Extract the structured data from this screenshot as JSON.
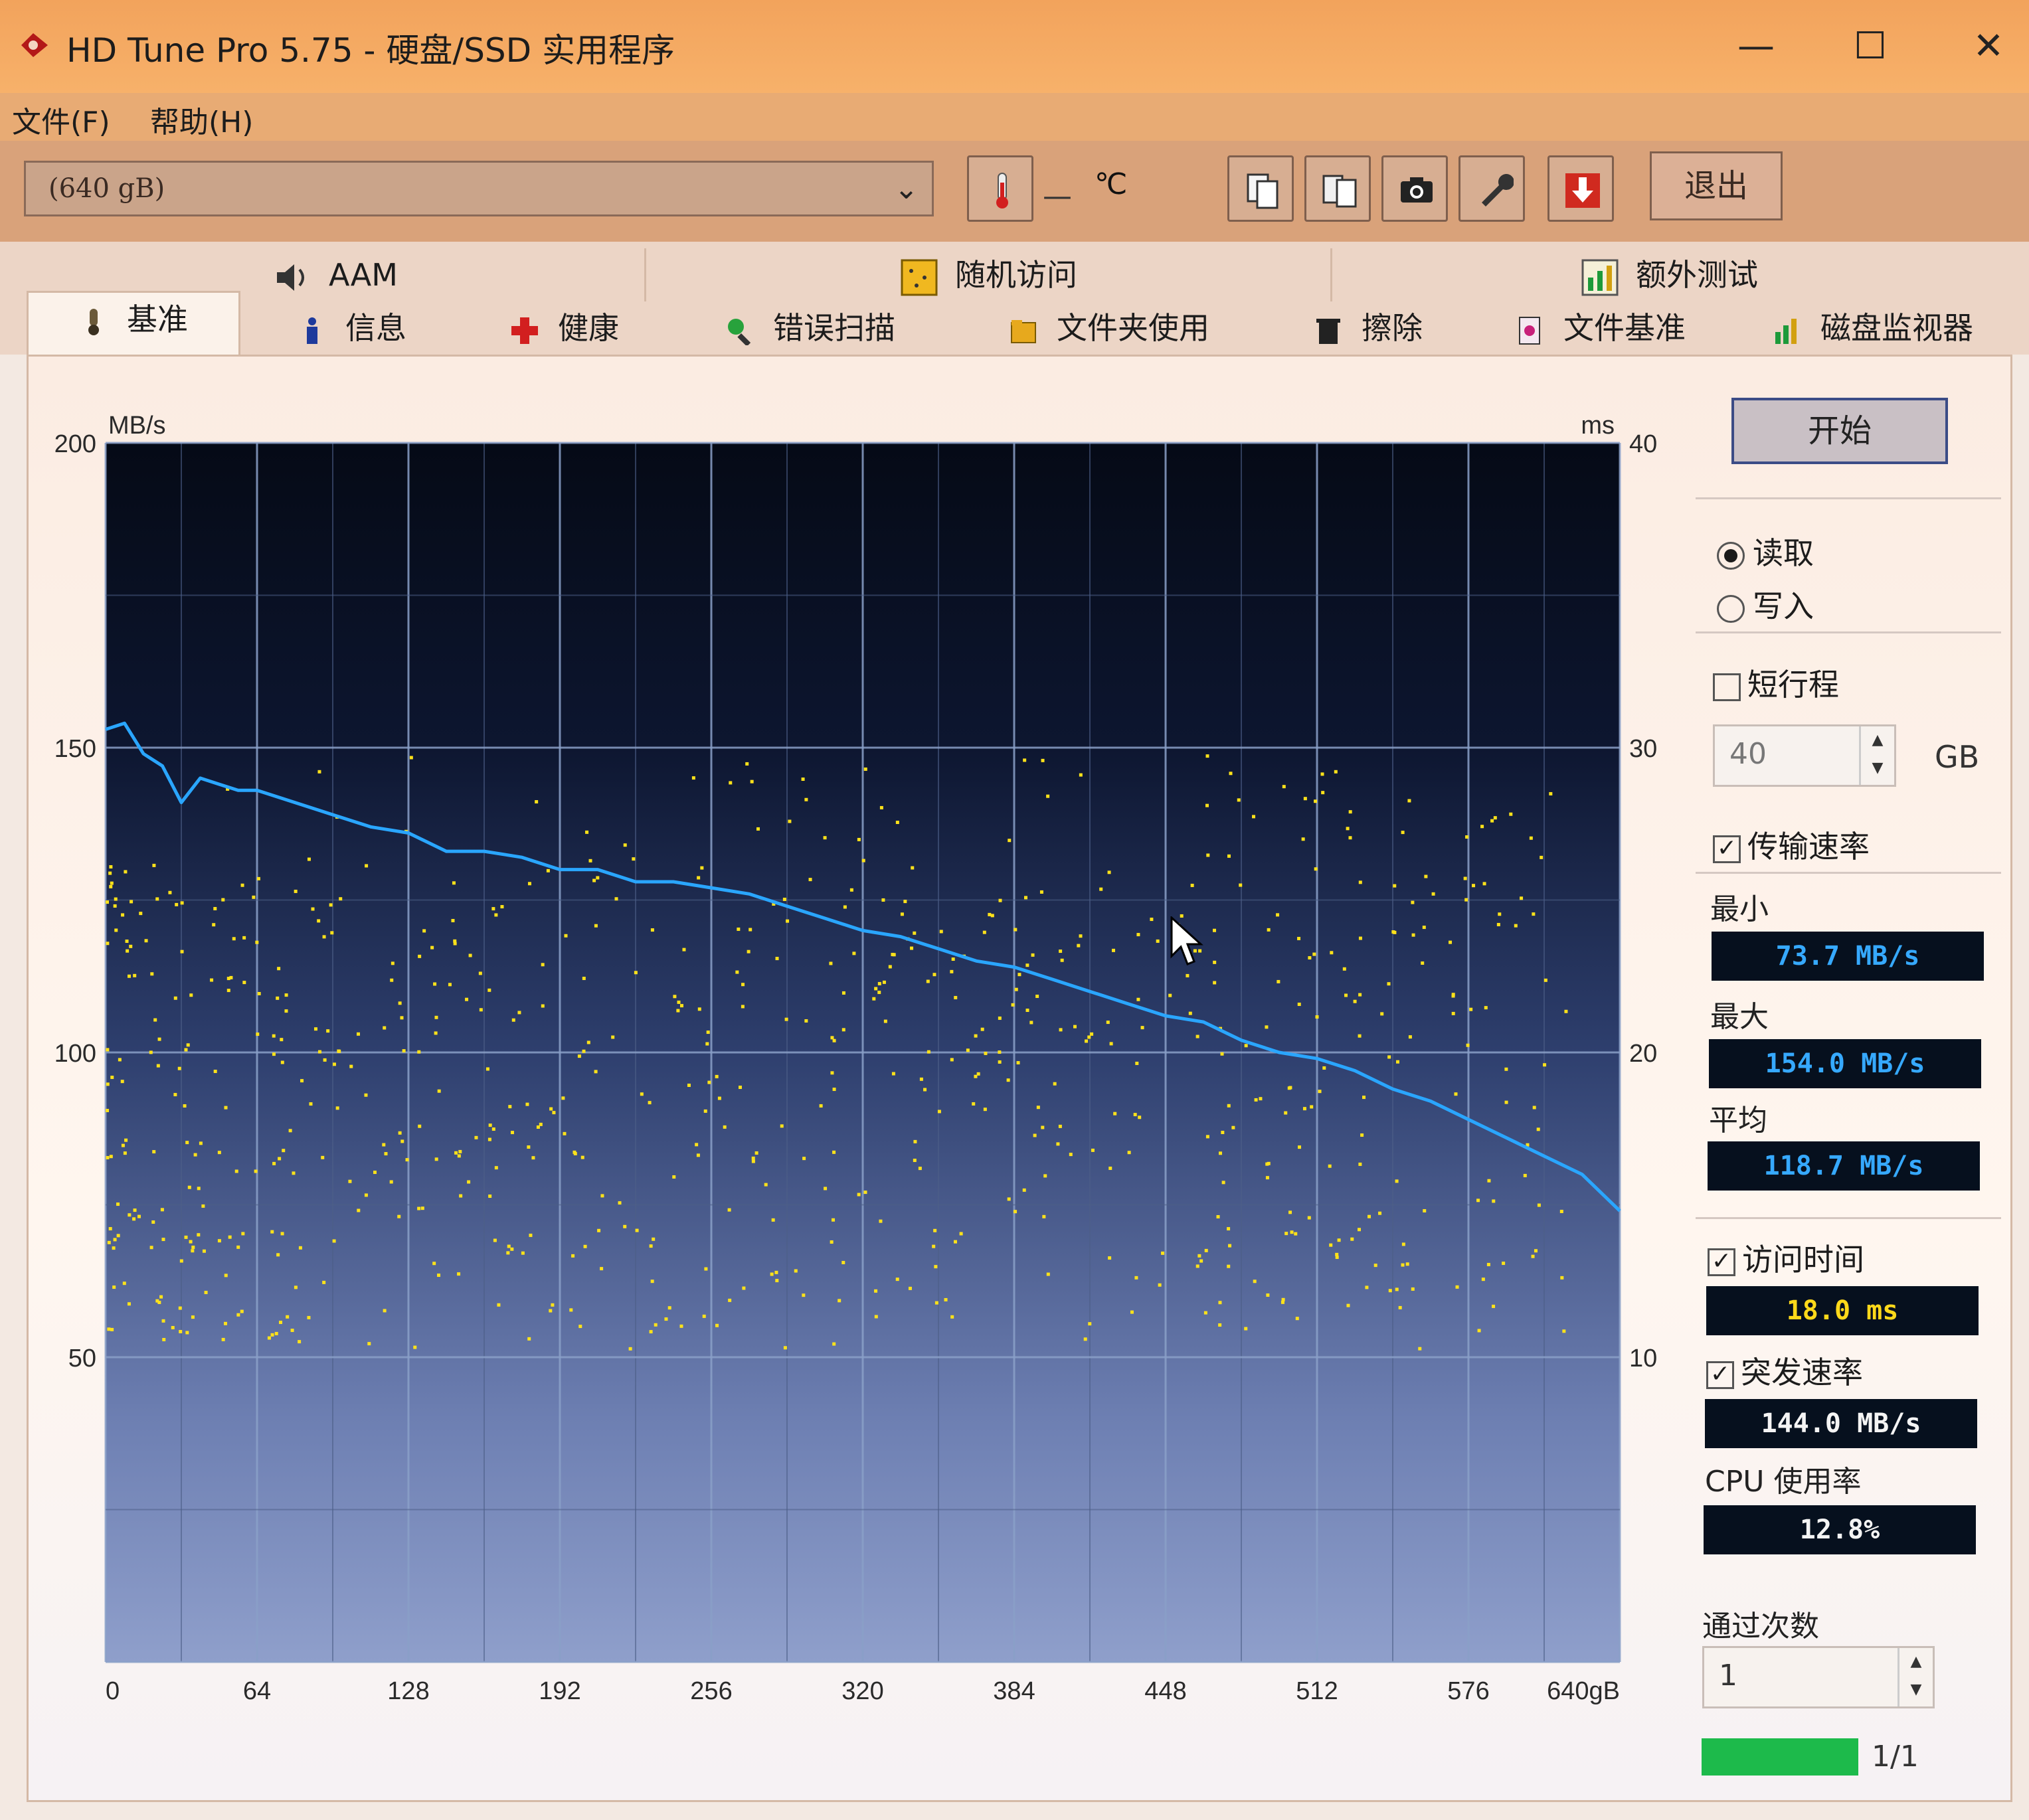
{
  "window": {
    "title": "HD Tune Pro 5.75 - 硬盘/SSD 实用程序",
    "minimize": "—",
    "maximize": "☐",
    "close": "✕"
  },
  "menu": [
    "文件(F)",
    "帮助(H)"
  ],
  "toolbar": {
    "drive": "(640 gB)",
    "temp_dash": "—",
    "temp_value": "℃",
    "exit_label": "退出"
  },
  "tabs_top": [
    {
      "label": "AAM",
      "icon": "speaker-icon"
    },
    {
      "label": "随机访问",
      "icon": "random-access-icon"
    },
    {
      "label": "额外测试",
      "icon": "extra-tests-icon"
    }
  ],
  "tabs": [
    {
      "label": "基准",
      "icon": "benchmark-icon",
      "active": true
    },
    {
      "label": "信息",
      "icon": "info-icon"
    },
    {
      "label": "健康",
      "icon": "health-cross-icon"
    },
    {
      "label": "错误扫描",
      "icon": "magnifier-icon"
    },
    {
      "label": "文件夹使用",
      "icon": "folder-icon"
    },
    {
      "label": "擦除",
      "icon": "erase-icon"
    },
    {
      "label": "文件基准",
      "icon": "file-benchmark-icon"
    },
    {
      "label": "磁盘监视器",
      "icon": "disk-monitor-icon"
    }
  ],
  "side": {
    "start_label": "开始",
    "read_label": "读取",
    "write_label": "写入",
    "short_stroke_label": "短行程",
    "short_stroke_value": "40",
    "short_stroke_unit": "GB",
    "transfer_rate_label": "传输速率",
    "min_label": "最小",
    "min_value": "73.7 MB/s",
    "max_label": "最大",
    "max_value": "154.0 MB/s",
    "avg_label": "平均",
    "avg_value": "118.7 MB/s",
    "access_time_label": "访问时间",
    "access_time_value": "18.0 ms",
    "burst_label": "突发速率",
    "burst_value": "144.0 MB/s",
    "cpu_label": "CPU 使用率",
    "cpu_value": "12.8%",
    "passes_label": "通过次数",
    "passes_value": "1",
    "progress_text": "1/1",
    "progress": 1.0
  },
  "chart_data": {
    "type": "line",
    "y_unit": "MB/s",
    "y2_unit": "ms",
    "ylim": [
      0,
      200
    ],
    "y2lim": [
      0,
      40
    ],
    "yticks": [
      "200",
      "150",
      "100",
      "50"
    ],
    "y2ticks": [
      "40",
      "30",
      "20",
      "10"
    ],
    "xlim": [
      0,
      640
    ],
    "xticks": [
      "0",
      "64",
      "128",
      "192",
      "256",
      "320",
      "384",
      "448",
      "512",
      "576",
      "640gB"
    ],
    "grid": true,
    "series": [
      {
        "color": "#2aa6ff",
        "x": [
          0,
          8,
          16,
          24,
          32,
          40,
          48,
          56,
          64,
          80,
          96,
          112,
          128,
          144,
          160,
          176,
          192,
          208,
          224,
          240,
          256,
          272,
          288,
          304,
          320,
          336,
          352,
          368,
          384,
          400,
          416,
          432,
          448,
          464,
          480,
          496,
          512,
          528,
          544,
          560,
          576,
          592,
          608,
          624,
          640
        ],
        "y": [
          153,
          154,
          149,
          147,
          141,
          145,
          144,
          143,
          143,
          141,
          139,
          137,
          136,
          133,
          133,
          132,
          130,
          130,
          128,
          128,
          127,
          126,
          124,
          122,
          120,
          119,
          117,
          115,
          114,
          112,
          110,
          108,
          106,
          105,
          102,
          100,
          99,
          97,
          94,
          92,
          89,
          86,
          83,
          80,
          74
        ]
      }
    ],
    "access_points_ms_range": [
      5,
      30
    ]
  }
}
